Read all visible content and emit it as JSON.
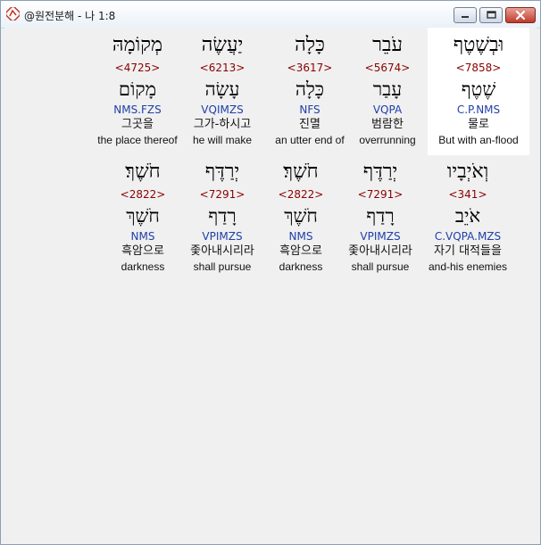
{
  "window": {
    "title": "@원전분해 - 나 1:8"
  },
  "rows": [
    {
      "words": [
        {
          "hebrew": "וּבְשֶׁטֶף",
          "strong": "<7858>",
          "lemma": "שֶׁטֶף",
          "morph": "C.P.NMS",
          "korean": "물로",
          "english": "But with an-flood",
          "selected": true
        },
        {
          "hebrew": "עֹבֵר",
          "strong": "<5674>",
          "lemma": "עָבַר",
          "morph": "VQPA",
          "korean": "범람한",
          "english": "overrunning",
          "selected": false
        },
        {
          "hebrew": "כָּלָה",
          "strong": "<3617>",
          "lemma": "כָּלָה",
          "morph": "NFS",
          "korean": "진멸",
          "english": "an utter end of",
          "selected": false
        },
        {
          "hebrew": "יַעֲשֶׂה",
          "strong": "<6213>",
          "lemma": "עָשָׂה",
          "morph": "VQIMZS",
          "korean": "그가-하시고",
          "english": "he will make",
          "selected": false
        },
        {
          "hebrew": "מְקוֹמָהּ",
          "strong": "<4725>",
          "lemma": "מָקוֹם",
          "morph": "NMS.FZS",
          "korean": "그곳을",
          "english": "the place thereof",
          "selected": false
        }
      ]
    },
    {
      "words": [
        {
          "hebrew": "וְאֹיְבָיו",
          "strong": "<341>",
          "lemma": "אֹיֵב",
          "morph": "C.VQPA.MZS",
          "korean": "자기 대적들을",
          "english": "and-his enemies",
          "selected": false
        },
        {
          "hebrew": "יְרַדֶּף",
          "strong": "<7291>",
          "lemma": "רָדַף",
          "morph": "VPIMZS",
          "korean": "좇아내시리라",
          "english": "shall pursue",
          "selected": false
        },
        {
          "hebrew": "חֹשֶׁךְ׃",
          "strong": "<2822>",
          "lemma": "חֹשֶׁךְ",
          "morph": "NMS",
          "korean": "흑암으로",
          "english": "darkness",
          "selected": false
        },
        {
          "hebrew": "יְרַדֶּף",
          "strong": "<7291>",
          "lemma": "רָדַף",
          "morph": "VPIMZS",
          "korean": "좇아내시리라",
          "english": "shall pursue",
          "selected": false
        },
        {
          "hebrew": "חֹשֶׁךְ׃",
          "strong": "<2822>",
          "lemma": "חֹשֶׁךְ",
          "morph": "NMS",
          "korean": "흑암으로",
          "english": "darkness",
          "selected": false
        }
      ]
    }
  ],
  "colors": {
    "strong": "#8b0000",
    "morph": "#1f3fa8",
    "selected_bg": "#ffffff",
    "background": "#f0f0f0"
  },
  "icons": {
    "app": "app-logo-icon",
    "minimize": "minimize-icon",
    "maximize": "maximize-icon",
    "close": "close-icon"
  }
}
